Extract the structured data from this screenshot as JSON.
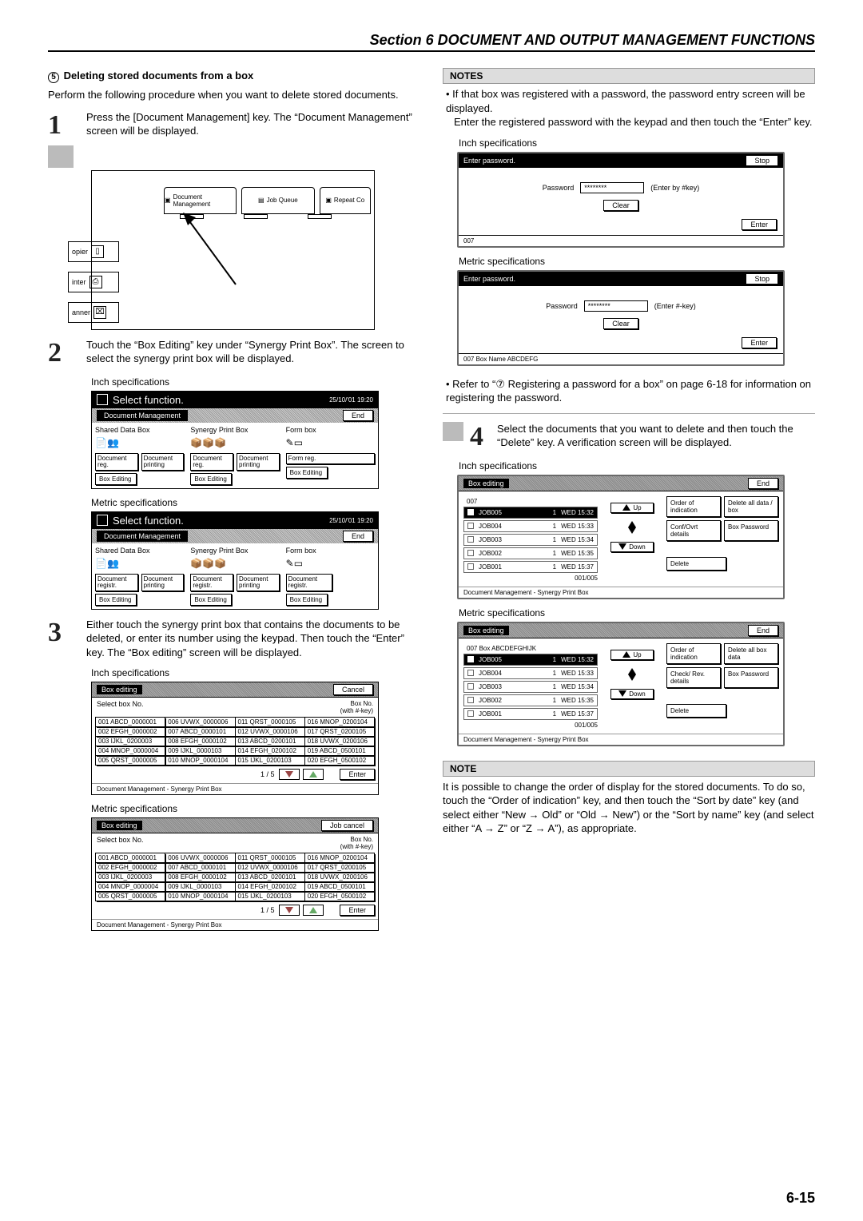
{
  "section_header": "Section 6  DOCUMENT AND OUTPUT MANAGEMENT FUNCTIONS",
  "h5_num": "5",
  "h5": "Deleting stored documents from a box",
  "intro": "Perform the following procedure when you want to delete stored documents.",
  "step1": {
    "num": "1",
    "text": "Press the [Document Management] key. The “Document Management” screen will be displayed."
  },
  "fig1": {
    "tabs": {
      "doc": "Document Management",
      "job": "Job Queue",
      "repeat": "Repeat Co"
    },
    "side": {
      "copier": "opier",
      "printer": "inter",
      "scanner": "anner"
    }
  },
  "step2": {
    "num": "2",
    "text": "Touch the “Box Editing” key under “Synergy Print Box”. The screen to select the synergy print box will be displayed."
  },
  "inch_spec": "Inch specifications",
  "metric_spec": "Metric specifications",
  "select_panel": {
    "title": "Select function.",
    "time_inch": "25/10/'01 19:20",
    "time_metric": "25/10/'01   19:20",
    "breadcrumb": "Document Management",
    "end": "End",
    "cols": {
      "shared": "Shared Data Box",
      "synergy": "Synergy Print Box",
      "form": "Form box"
    },
    "btns": {
      "doc_reg": "Document reg.",
      "doc_print": "Document printing",
      "doc_registr": "Document registr.",
      "form_reg": "Form reg.",
      "box_edit": "Box Editing"
    }
  },
  "step3": {
    "num": "3",
    "text": "Either touch the synergy print box that contains the documents to be deleted, or enter its number using the keypad. Then touch the “Enter” key. The “Box editing” screen will be displayed."
  },
  "boxsel": {
    "title": "Box editing",
    "cancel": "Cancel",
    "job_cancel": "Job cancel",
    "subhead": "Select box No.",
    "boxno": "Box No.",
    "withkey": "(with #-key)",
    "rows": [
      [
        "001 ABCD_0000001",
        "006 UVWX_0000006",
        "011 QRST_0000105",
        "016 MNOP_0200104"
      ],
      [
        "002 EFGH_0000002",
        "007  ABCD_0000101",
        "012 UVWX_0000106",
        "017 QRST_0200105"
      ],
      [
        "003    IJKL_0200003",
        "008  EFGH_0000102",
        "013 ABCD_0200101",
        "018 UVWX_0200106"
      ],
      [
        "004 MNOP_0000004",
        "009     IJKL_0000103",
        "014 EFGH_0200102",
        "019 ABCD_0500101"
      ],
      [
        "005 QRST_0000005",
        "010 MNOP_0000104",
        "015    IJKL_0200103",
        "020 EFGH_0500102"
      ]
    ],
    "pager": "1 / 5",
    "enter": "Enter",
    "footer": "Document Management - Synergy Print Box"
  },
  "notes_hdr": "NOTES",
  "note_hdr": "NOTE",
  "notes_body_1": "If that box was registered with a password, the password entry screen will be displayed.",
  "notes_body_2": "Enter the registered password with the keypad and then touch the “Enter” key.",
  "pwd": {
    "title": "Enter password.",
    "stop": "Stop",
    "label": "Password",
    "mask": "********",
    "hint_inch": "(Enter by #key)",
    "hint_metric": "(Enter #-key)",
    "clear": "Clear",
    "enter": "Enter",
    "foot_inch": "007",
    "foot_metric": "007   Box Name ABCDEFG"
  },
  "refer": "Refer to “⑦   Registering a password for a box” on page 6-18 for information on registering the password.",
  "step4": {
    "num": "4",
    "text": "Select the documents that you want to delete and then touch the “Delete” key. A verification screen will be displayed."
  },
  "boxedit": {
    "title": "Box editing",
    "end": "End",
    "hdr_inch": "007",
    "hdr_metric": "007 Box ABCDEFGHIJK",
    "jobs": [
      {
        "id": "JOB005",
        "n": "1",
        "time": "WED 15:32",
        "sel": true
      },
      {
        "id": "JOB004",
        "n": "1",
        "time": "WED 15:33",
        "sel": false
      },
      {
        "id": "JOB003",
        "n": "1",
        "time": "WED 15:34",
        "sel": false
      },
      {
        "id": "JOB002",
        "n": "1",
        "time": "WED 15:35",
        "sel": false
      },
      {
        "id": "JOB001",
        "n": "1",
        "time": "WED 15:37",
        "sel": false
      }
    ],
    "count": "001/005",
    "up": "Up",
    "down": "Down",
    "order": "Order of indication",
    "delete_all_inch": "Delete all data / box",
    "delete_all_metric": "Delete all box data",
    "conf_inch": "Conf/Ovrt details",
    "conf_metric": "Check/ Rev. details",
    "box_pwd": "Box Password",
    "delete": "Delete",
    "footer": "Document Management - Synergy Print Box"
  },
  "final_note": "It is possible to change the order of display for the stored documents. To do so, touch the “Order of indication” key, and then touch the “Sort by date” key (and select either “New → Old” or “Old → New”) or the “Sort by name” key (and select either “A → Z” or “Z → A”), as appropriate.",
  "page_no": "6-15"
}
